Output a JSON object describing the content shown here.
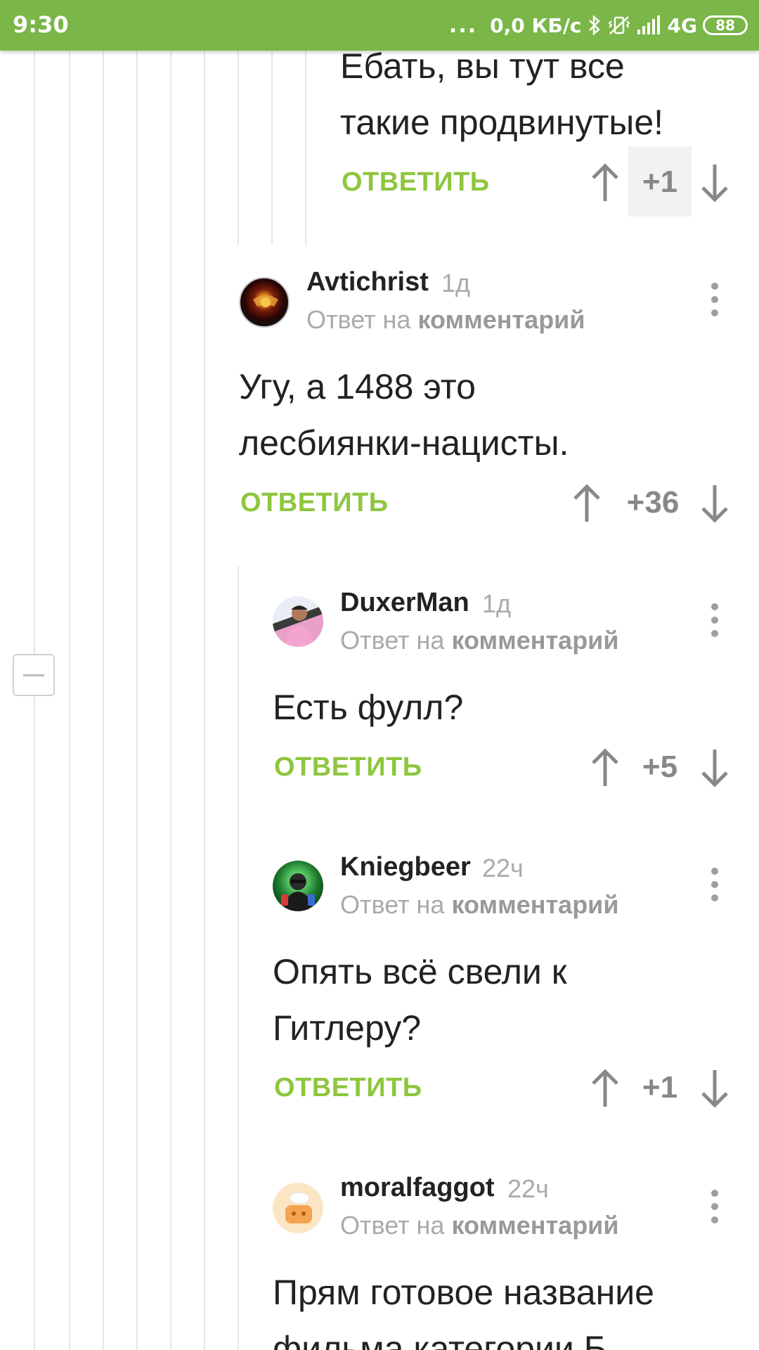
{
  "status_bar": {
    "time": "9:30",
    "dots": "...",
    "network_speed": "0,0 КБ/с",
    "network_type": "4G",
    "battery": "88"
  },
  "comments": [
    {
      "text_lines": [
        "Ебать, вы тут все",
        "такие продвинутые!"
      ],
      "reply_label": "ОТВЕТИТЬ",
      "score": "+1"
    },
    {
      "author": "Avtichrist",
      "time": "1д",
      "meta_prefix": "Ответ на",
      "meta_link": "комментарий",
      "text_lines": [
        "Угу, а 1488 это",
        "лесбиянки-нацисты."
      ],
      "reply_label": "ОТВЕТИТЬ",
      "score": "+36"
    },
    {
      "author": "DuxerMan",
      "time": "1д",
      "meta_prefix": "Ответ на",
      "meta_link": "комментарий",
      "text_lines": [
        "Есть фулл?"
      ],
      "reply_label": "ОТВЕТИТЬ",
      "score": "+5"
    },
    {
      "author": "Kniegbeer",
      "time": "22ч",
      "meta_prefix": "Ответ на",
      "meta_link": "комментарий",
      "text_lines": [
        "Опять всё свели к",
        "Гитлеру?"
      ],
      "reply_label": "ОТВЕТИТЬ",
      "score": "+1"
    },
    {
      "author": "moralfaggot",
      "time": "22ч",
      "meta_prefix": "Ответ на",
      "meta_link": "комментарий",
      "text_lines": [
        "Прям готовое название",
        "фильма категории Б"
      ]
    }
  ]
}
